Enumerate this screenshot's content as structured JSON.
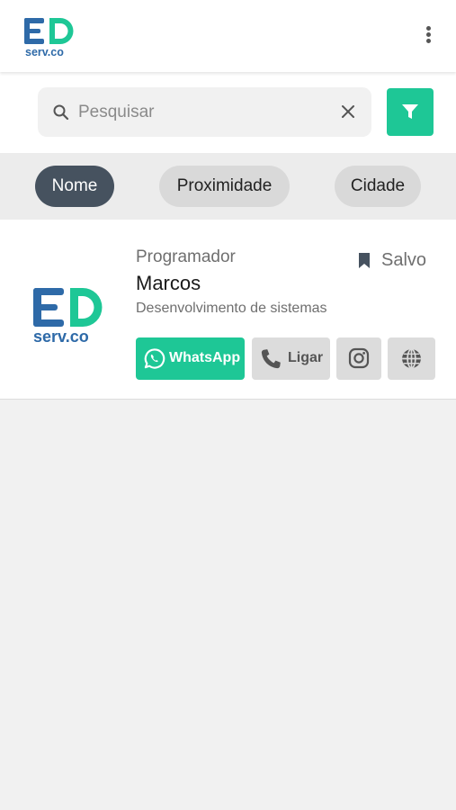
{
  "header": {
    "logo_text": "serv.co",
    "logo_initials": "ED",
    "menu_icon": "kebab-menu-icon"
  },
  "search": {
    "placeholder": "Pesquisar",
    "value": "",
    "search_icon": "search-icon",
    "clear_icon": "close-icon",
    "filter_icon": "filter-icon"
  },
  "sort": {
    "chips": [
      {
        "label": "Nome",
        "active": true
      },
      {
        "label": "Proximidade",
        "active": false
      },
      {
        "label": "Cidade",
        "active": false
      }
    ]
  },
  "results": [
    {
      "category": "Programador",
      "name": "Marcos",
      "description": "Desenvolvimento de sistemas",
      "saved_label": "Salvo",
      "saved_icon": "bookmark-icon",
      "actions": {
        "whatsapp_label": "WhatsApp",
        "call_label": "Ligar",
        "instagram_icon": "instagram-icon",
        "website_icon": "globe-icon"
      }
    }
  ],
  "colors": {
    "brand_green": "#1ec796",
    "brand_blue": "#2e6aa8",
    "chip_active": "#46525f",
    "background": "#f1f1f1"
  }
}
